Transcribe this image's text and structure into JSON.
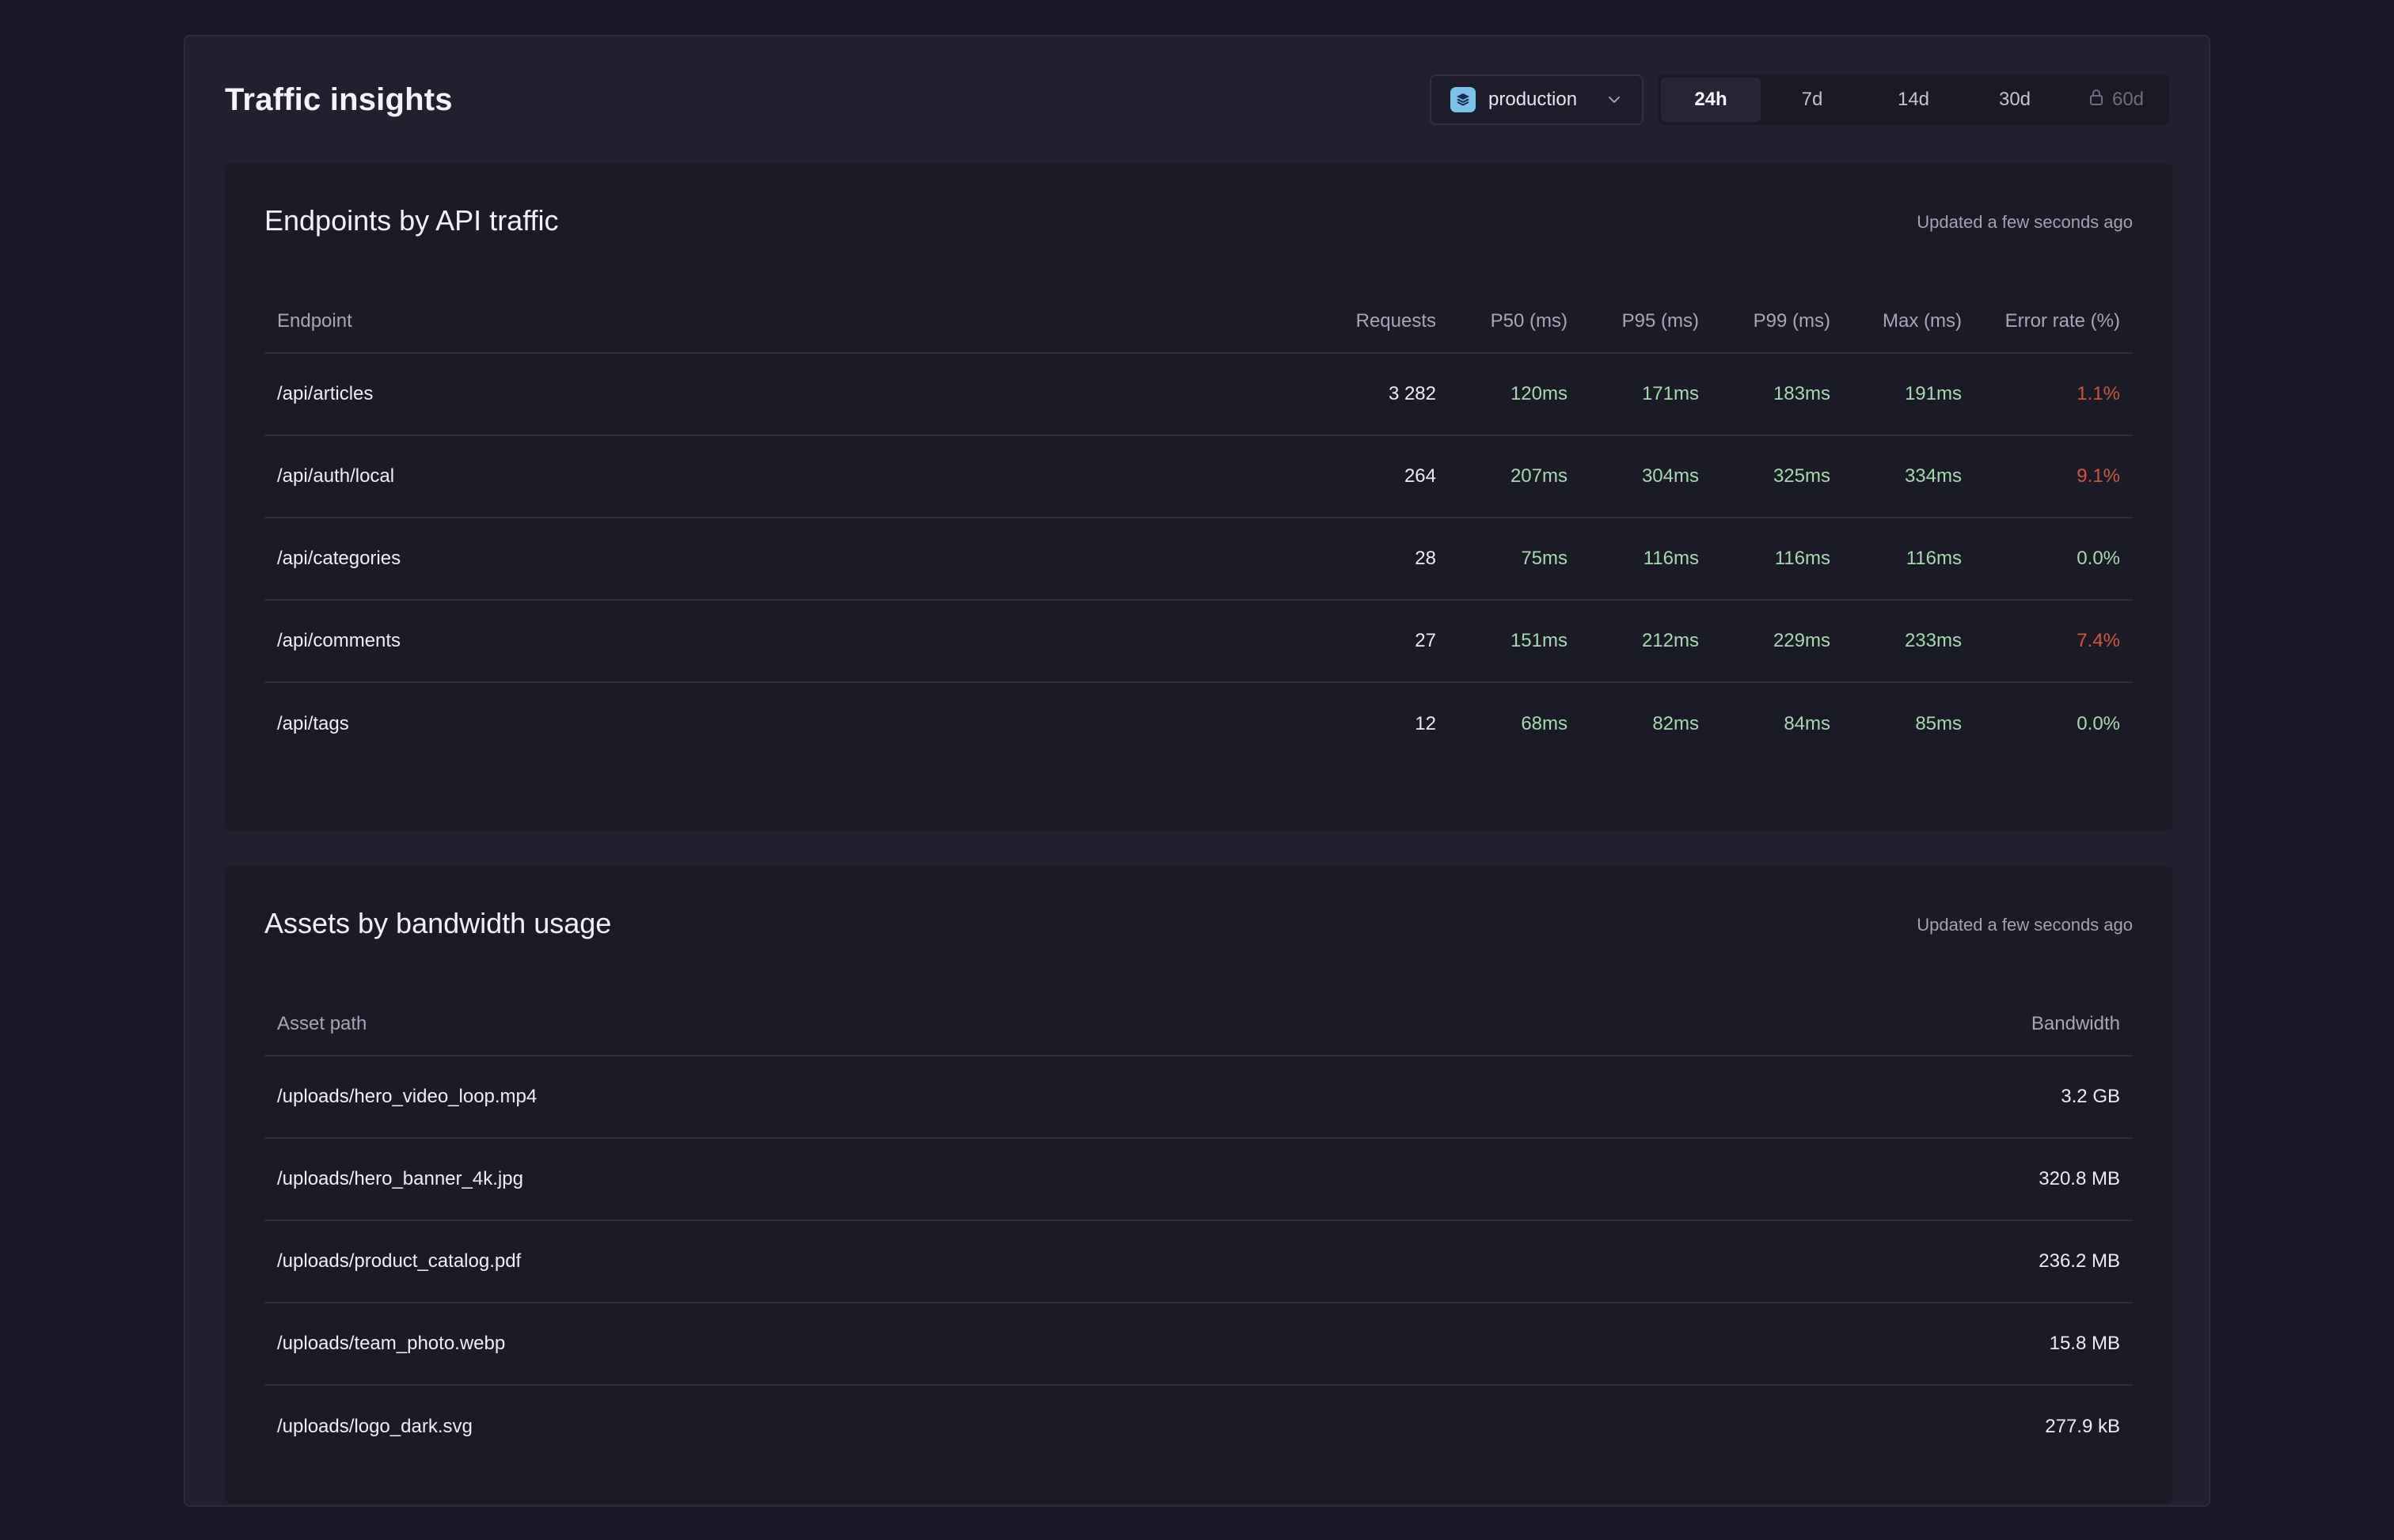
{
  "page": {
    "title": "Traffic insights"
  },
  "environment": {
    "label": "production",
    "icon": "stack-icon"
  },
  "ranges": [
    {
      "label": "24h",
      "active": true,
      "locked": false
    },
    {
      "label": "7d",
      "active": false,
      "locked": false
    },
    {
      "label": "14d",
      "active": false,
      "locked": false
    },
    {
      "label": "30d",
      "active": false,
      "locked": false
    },
    {
      "label": "60d",
      "active": false,
      "locked": true
    }
  ],
  "endpoints": {
    "title": "Endpoints by API traffic",
    "updated": "Updated a few seconds ago",
    "columns": [
      "Endpoint",
      "Requests",
      "P50 (ms)",
      "P95 (ms)",
      "P99 (ms)",
      "Max (ms)",
      "Error rate (%)"
    ],
    "rows": [
      {
        "endpoint": "/api/articles",
        "requests": "3 282",
        "p50": "120ms",
        "p95": "171ms",
        "p99": "183ms",
        "max": "191ms",
        "error_rate": "1.1%",
        "error_color": "#c9553a"
      },
      {
        "endpoint": "/api/auth/local",
        "requests": "264",
        "p50": "207ms",
        "p95": "304ms",
        "p99": "325ms",
        "max": "334ms",
        "error_rate": "9.1%",
        "error_color": "#d4553e"
      },
      {
        "endpoint": "/api/categories",
        "requests": "28",
        "p50": "75ms",
        "p95": "116ms",
        "p99": "116ms",
        "max": "116ms",
        "error_rate": "0.0%",
        "error_color": "#a8d8b0"
      },
      {
        "endpoint": "/api/comments",
        "requests": "27",
        "p50": "151ms",
        "p95": "212ms",
        "p99": "229ms",
        "max": "233ms",
        "error_rate": "7.4%",
        "error_color": "#d4553e"
      },
      {
        "endpoint": "/api/tags",
        "requests": "12",
        "p50": "68ms",
        "p95": "82ms",
        "p99": "84ms",
        "max": "85ms",
        "error_rate": "0.0%",
        "error_color": "#a8d8b0"
      }
    ]
  },
  "assets": {
    "title": "Assets by bandwidth usage",
    "updated": "Updated a few seconds ago",
    "columns": [
      "Asset path",
      "Bandwidth"
    ],
    "rows": [
      {
        "path": "/uploads/hero_video_loop.mp4",
        "bandwidth": "3.2 GB"
      },
      {
        "path": "/uploads/hero_banner_4k.jpg",
        "bandwidth": "320.8 MB"
      },
      {
        "path": "/uploads/product_catalog.pdf",
        "bandwidth": "236.2 MB"
      },
      {
        "path": "/uploads/team_photo.webp",
        "bandwidth": "15.8 MB"
      },
      {
        "path": "/uploads/logo_dark.svg",
        "bandwidth": "277.9 kB"
      }
    ]
  }
}
